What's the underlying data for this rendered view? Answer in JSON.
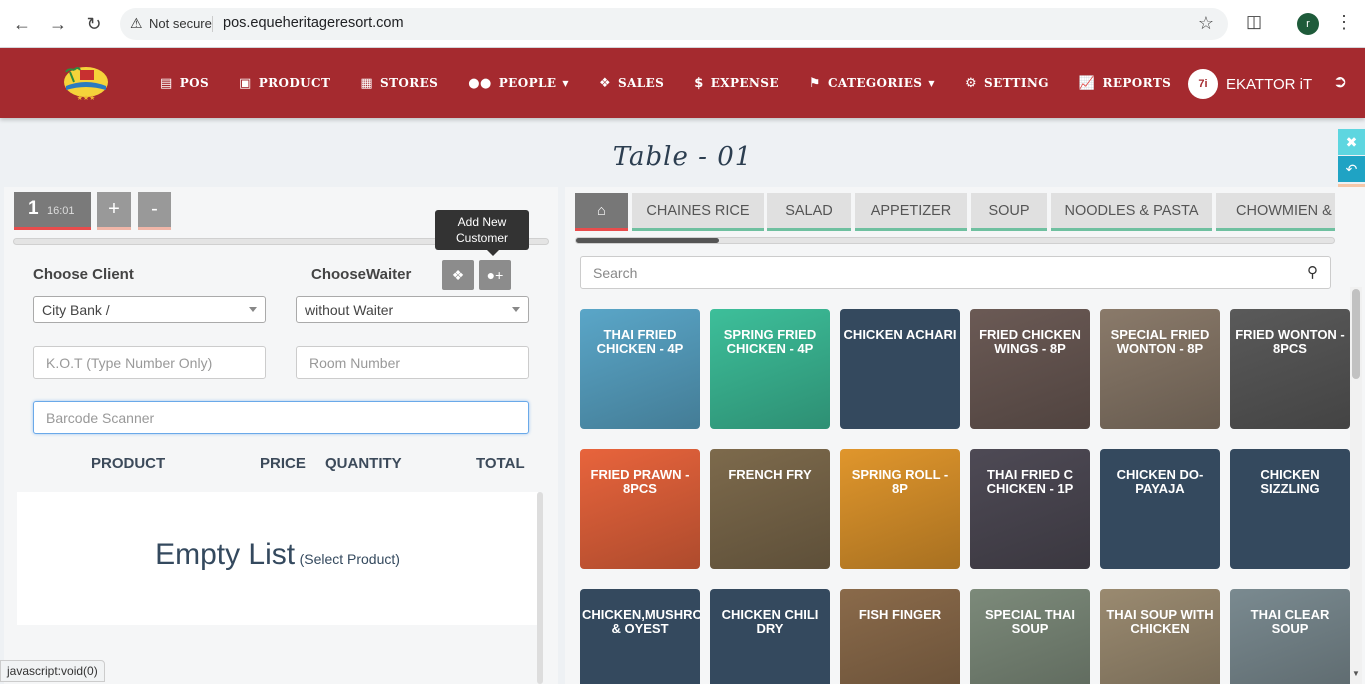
{
  "browser": {
    "security_label": "Not secure",
    "url": "pos.equeheritageresort.com",
    "profile_initial": "r"
  },
  "header": {
    "menu": [
      {
        "icon": "card-icon",
        "label": "POS",
        "dropdown": false
      },
      {
        "icon": "product-icon",
        "label": "PRODUCT",
        "dropdown": false
      },
      {
        "icon": "store-icon",
        "label": "STORES",
        "dropdown": false
      },
      {
        "icon": "people-icon",
        "label": "PEOPLE",
        "dropdown": true
      },
      {
        "icon": "tag-icon",
        "label": "SALES",
        "dropdown": false
      },
      {
        "icon": "dollar-icon",
        "label": "EXPENSE",
        "dropdown": false
      },
      {
        "icon": "bookmark-icon",
        "label": "CATEGORIES",
        "dropdown": true
      },
      {
        "icon": "gears-icon",
        "label": "SETTING",
        "dropdown": false
      },
      {
        "icon": "line-chart-icon",
        "label": "REPORTS",
        "dropdown": false
      }
    ],
    "brand_badge": "7i",
    "brand_name": "EKATTOR iT",
    "accent": "#a52a2f"
  },
  "page_title": "Table - 01",
  "order": {
    "tab_number": "1",
    "tab_time": "16:01",
    "add_label": "+",
    "remove_label": "-"
  },
  "tooltip": "Add New Customer",
  "form": {
    "client_label": "Choose Client",
    "waiter_label": "ChooseWaiter",
    "client_value": "City Bank /",
    "waiter_value": "without Waiter",
    "kot_placeholder": "K.O.T (Type Number Only)",
    "room_placeholder": "Room Number",
    "barcode_placeholder": "Barcode Scanner"
  },
  "cart": {
    "headers": [
      "PRODUCT",
      "PRICE",
      "QUANTITY",
      "TOTAL"
    ],
    "empty_big": "Empty List",
    "empty_small": "(Select Product)"
  },
  "categories": [
    "CHAINES RICE",
    "SALAD",
    "APPETIZER",
    "SOUP",
    "NOODLES & PASTA",
    "CHOWMIEN & C"
  ],
  "search_placeholder": "Search",
  "products": [
    {
      "name": "THAI FRIED CHICKEN - 4P",
      "bg": "#5aa6c8",
      "image": true
    },
    {
      "name": "SPRING FRIED CHICKEN - 4P",
      "bg": "#3dbf9a",
      "image": true
    },
    {
      "name": "CHICKEN ACHARI",
      "bg": "#34495e",
      "image": false
    },
    {
      "name": "FRIED CHICKEN WINGS - 8P",
      "bg": "#6b5a55",
      "image": true
    },
    {
      "name": "SPECIAL FRIED WONTON - 8P",
      "bg": "#8a7a6a",
      "image": true
    },
    {
      "name": "FRIED WONTON - 8PCS",
      "bg": "#5a5a5a",
      "image": true
    },
    {
      "name": "FRIED PRAWN - 8PCS",
      "bg": "#e8643c",
      "image": true
    },
    {
      "name": "FRENCH FRY",
      "bg": "#7d6a4c",
      "image": true
    },
    {
      "name": "SPRING ROLL - 8P",
      "bg": "#e0962c",
      "image": true
    },
    {
      "name": "THAI FRIED C CHICKEN - 1P",
      "bg": "#4e4a55",
      "image": true
    },
    {
      "name": "CHICKEN DO-PAYAJA",
      "bg": "#34495e",
      "image": false
    },
    {
      "name": "CHICKEN SIZZLING",
      "bg": "#34495e",
      "image": false
    },
    {
      "name": "CHICKEN,MUSHROOM & OYEST",
      "bg": "#34495e",
      "image": false
    },
    {
      "name": "CHICKEN CHILI DRY",
      "bg": "#34495e",
      "image": false
    },
    {
      "name": "FISH FINGER",
      "bg": "#8a6a4a",
      "image": true
    },
    {
      "name": "SPECIAL THAI SOUP",
      "bg": "#7c8a7a",
      "image": true
    },
    {
      "name": "THAI SOUP WITH CHICKEN",
      "bg": "#9a8a70",
      "image": true
    },
    {
      "name": "THAI CLEAR SOUP",
      "bg": "#7a8a90",
      "image": true
    }
  ],
  "status_bar": "javascript:void(0)"
}
